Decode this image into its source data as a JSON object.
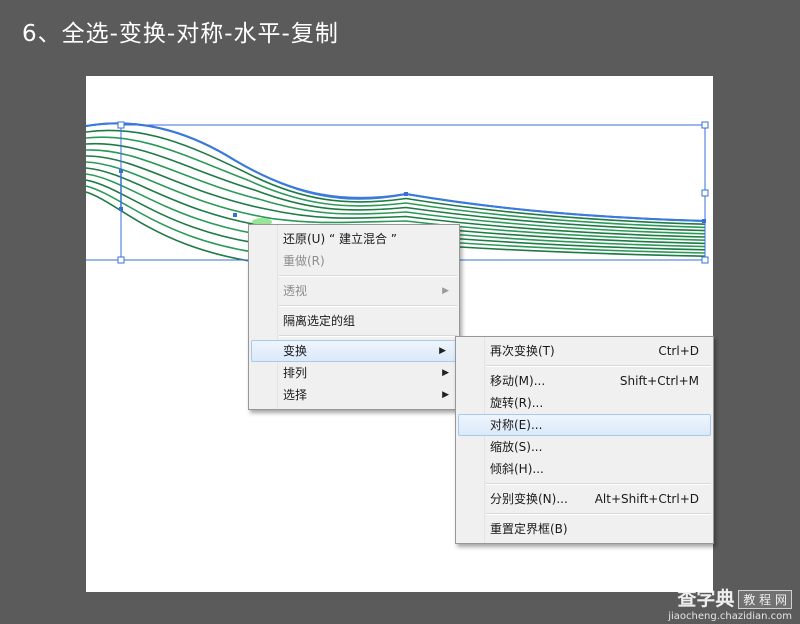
{
  "title": "6、全选-变换-对称-水平-复制",
  "colors": {
    "background": "#5b5b5b",
    "canvas": "#ffffff",
    "selection": "#3a6fd8",
    "curves_dark": "#1f6b3a",
    "curves_light": "#2fa05a"
  },
  "context_menu": {
    "undo": "还原(U) “ 建立混合 ”",
    "redo": "重做(R)",
    "perspective": "透视",
    "isolate": "隔离选定的组",
    "transform": "变换",
    "arrange": "排列",
    "select": "选择"
  },
  "transform_submenu": {
    "transform_again": {
      "label": "再次变换(T)",
      "shortcut": "Ctrl+D"
    },
    "move": {
      "label": "移动(M)...",
      "shortcut": "Shift+Ctrl+M"
    },
    "rotate": {
      "label": "旋转(R)..."
    },
    "reflect": {
      "label": "对称(E)..."
    },
    "scale": {
      "label": "缩放(S)..."
    },
    "shear": {
      "label": "倾斜(H)..."
    },
    "transform_each": {
      "label": "分别变换(N)...",
      "shortcut": "Alt+Shift+Ctrl+D"
    },
    "reset_bbox": {
      "label": "重置定界框(B)"
    }
  },
  "watermark": {
    "brand": "查字典",
    "sub": "教 程 网",
    "url": "jiaocheng.chazidian.com"
  }
}
